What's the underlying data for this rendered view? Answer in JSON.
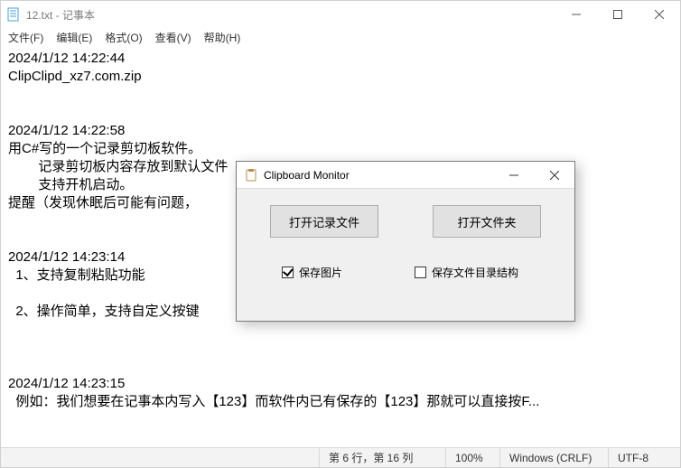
{
  "notepad": {
    "title": "12.txt - 记事本",
    "menu": {
      "file": "文件(F)",
      "edit": "编辑(E)",
      "format": "格式(O)",
      "view": "查看(V)",
      "help": "帮助(H)"
    },
    "content_lines": [
      "2024/1/12 14:22:44",
      "ClipClipd_xz7.com.zip",
      "",
      "",
      "2024/1/12 14:22:58",
      "用C#写的一个记录剪切板软件。",
      "\t记录剪切板内容存放到默认文件",
      "\t支持开机启动。",
      "提醒（发现休眠后可能有问题，",
      "",
      "",
      "2024/1/12 14:23:14",
      "  1、支持复制粘贴功能",
      "",
      "  2、操作简单，支持自定义按键",
      "",
      "",
      "",
      "2024/1/12 14:23:15",
      "  例如：我们想要在记事本内写入【123】而软件内已有保存的【123】那就可以直接按F..."
    ],
    "status": {
      "pos": "第 6 行，第 16 列",
      "zoom": "100%",
      "eol": "Windows (CRLF)",
      "encoding": "UTF-8"
    }
  },
  "dialog": {
    "title": "Clipboard Monitor",
    "btn_open_log": "打开记录文件",
    "btn_open_folder": "打开文件夹",
    "chk_save_image": "保存图片",
    "chk_save_image_checked": true,
    "chk_save_tree": "保存文件目录结构",
    "chk_save_tree_checked": false
  }
}
